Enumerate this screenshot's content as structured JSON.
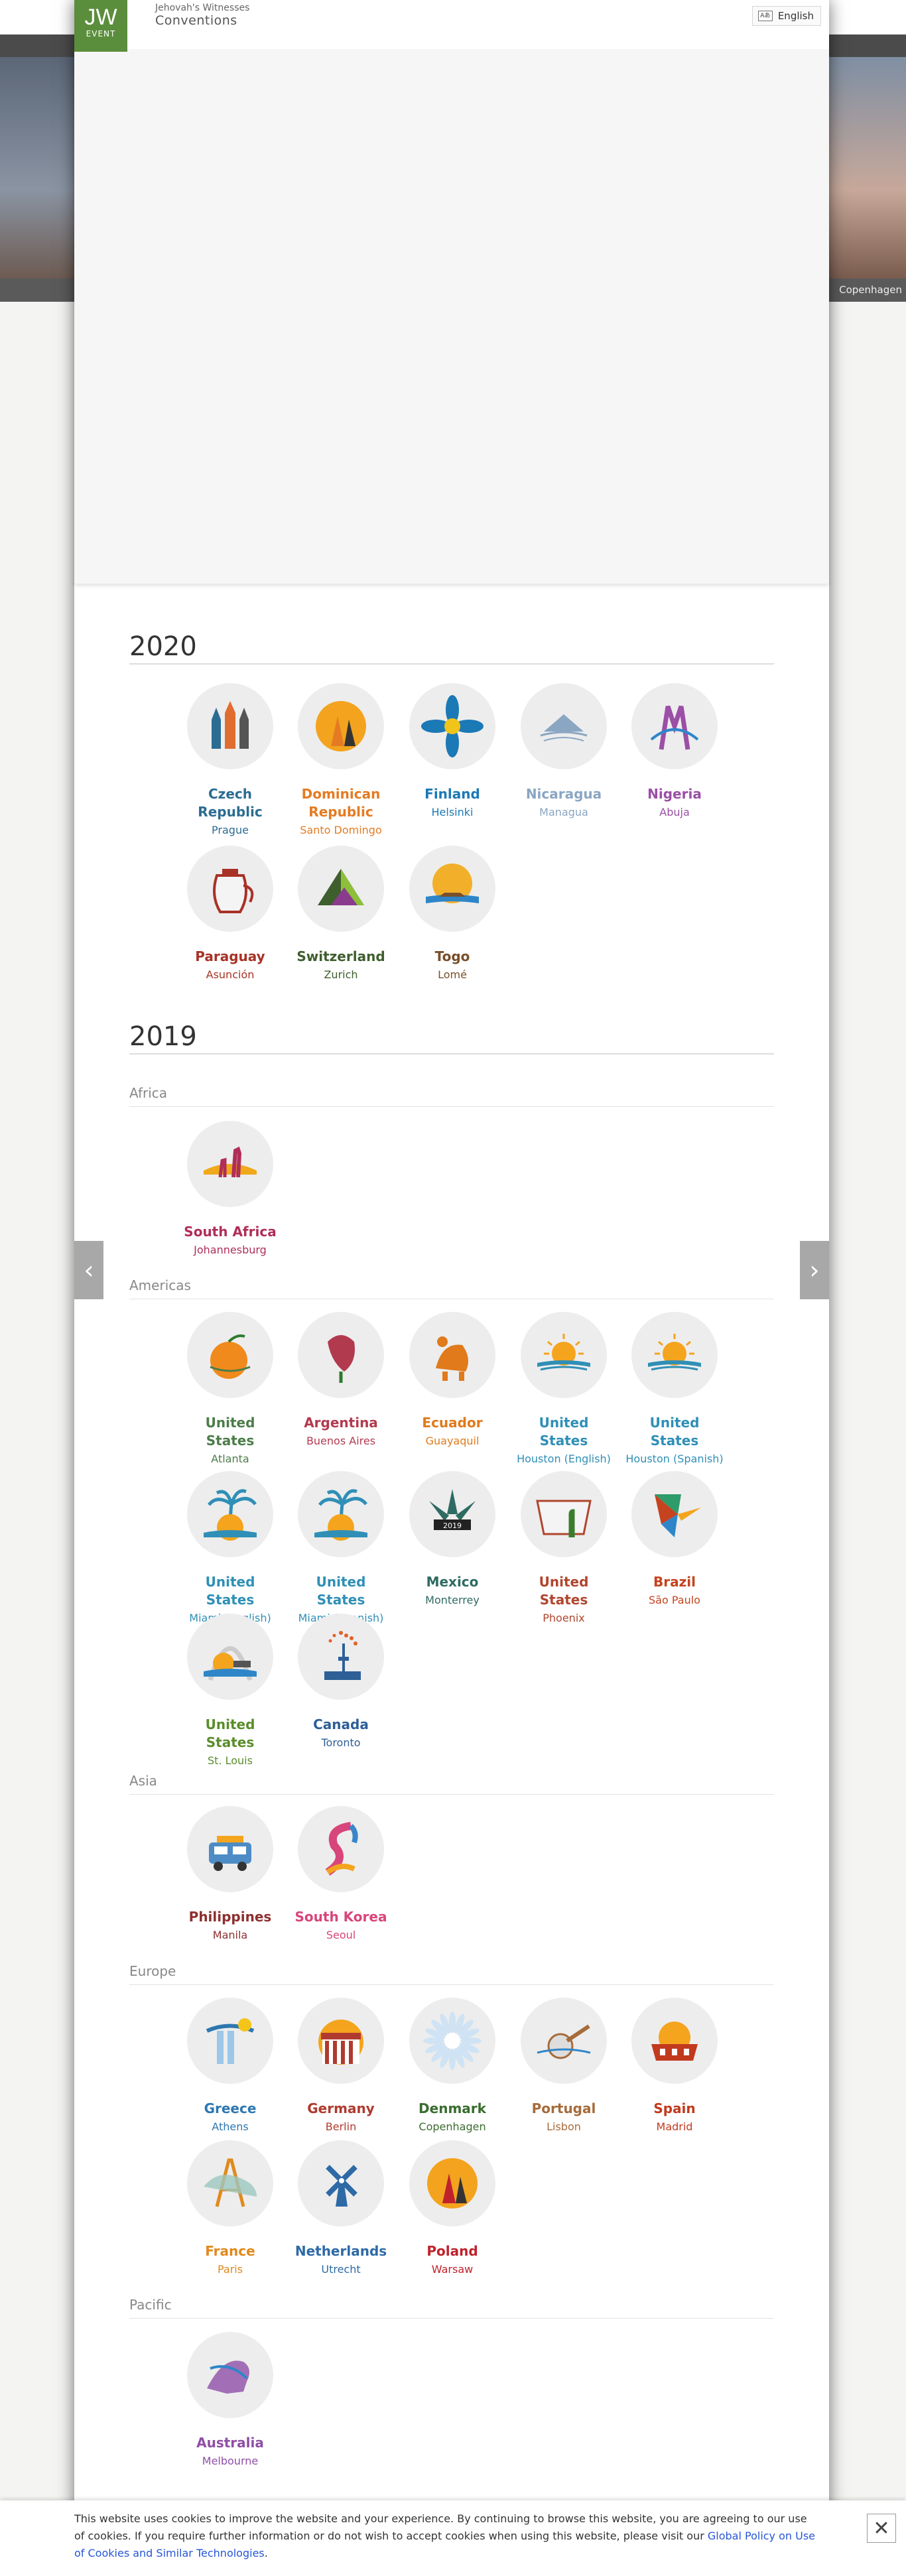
{
  "header": {
    "logo_main": "JW",
    "logo_sub": "EVENT",
    "org": "Jehovah's Witnesses",
    "site": "Conventions",
    "lang_icon": "Aあ",
    "language": "English"
  },
  "hero": {
    "caption": "Copenhagen"
  },
  "years": [
    {
      "label": "2020",
      "events": [
        {
          "country": "Czech Republic",
          "city": "Prague",
          "color": "#2b6c92",
          "icon": "castle-icon"
        },
        {
          "country": "Dominican Republic",
          "city": "Santo Domingo",
          "color": "#e47b22",
          "icon": "dancers-icon"
        },
        {
          "country": "Finland",
          "city": "Helsinki",
          "color": "#1b79b6",
          "icon": "flower-icon"
        },
        {
          "country": "Nicaragua",
          "city": "Managua",
          "color": "#8aa6c2",
          "icon": "volcano-icon"
        },
        {
          "country": "Nigeria",
          "city": "Abuja",
          "color": "#9b4fa6",
          "icon": "bridge-icon"
        },
        {
          "country": "Paraguay",
          "city": "Asunción",
          "color": "#a83226",
          "icon": "teapot-icon"
        },
        {
          "country": "Switzerland",
          "city": "Zurich",
          "color": "#3f5e2e",
          "icon": "mountain-icon"
        },
        {
          "country": "Togo",
          "city": "Lomé",
          "color": "#7a4f2a",
          "icon": "boat-icon"
        }
      ]
    },
    {
      "label": "2019",
      "regions": [
        {
          "name": "Africa",
          "events": [
            {
              "country": "South Africa",
              "city": "Johannesburg",
              "color": "#b02e57",
              "icon": "giraffe-icon"
            }
          ]
        },
        {
          "name": "Americas",
          "events": [
            {
              "country": "United States",
              "city": "Atlanta",
              "color": "#4c7d49",
              "icon": "peach-icon"
            },
            {
              "country": "Argentina",
              "city": "Buenos Aires",
              "color": "#b23a4f",
              "icon": "ceibo-flower-icon"
            },
            {
              "country": "Ecuador",
              "city": "Guayaquil",
              "color": "#e07a1b",
              "icon": "tortoise-icon"
            },
            {
              "country": "United States",
              "city": "Houston (English)",
              "color": "#2f8fb6",
              "icon": "sun-boat-icon"
            },
            {
              "country": "United States",
              "city": "Houston (Spanish)",
              "color": "#2f8fb6",
              "icon": "sun-boat-icon"
            },
            {
              "country": "United States",
              "city": "Miami (English)",
              "color": "#2f8fb6",
              "icon": "palm-island-icon"
            },
            {
              "country": "United States",
              "city": "Miami (Spanish)",
              "color": "#2f8fb6",
              "icon": "palm-island-icon"
            },
            {
              "country": "Mexico",
              "city": "Monterrey",
              "color": "#2e6b62",
              "icon": "agave-icon"
            },
            {
              "country": "United States",
              "city": "Phoenix",
              "color": "#b0462e",
              "icon": "cactus-icon"
            },
            {
              "country": "Brazil",
              "city": "São Paulo",
              "color": "#c5431f",
              "icon": "hummingbird-icon"
            },
            {
              "country": "United States",
              "city": "St. Louis",
              "color": "#5a8d2b",
              "icon": "arch-icon"
            },
            {
              "country": "Canada",
              "city": "Toronto",
              "color": "#2e5f97",
              "icon": "cn-tower-icon"
            }
          ]
        },
        {
          "name": "Asia",
          "events": [
            {
              "country": "Philippines",
              "city": "Manila",
              "color": "#8d2f2f",
              "icon": "jeepney-icon"
            },
            {
              "country": "South Korea",
              "city": "Seoul",
              "color": "#d8457a",
              "icon": "ribbon-icon"
            }
          ]
        },
        {
          "name": "Europe",
          "events": [
            {
              "country": "Greece",
              "city": "Athens",
              "color": "#2e77b0",
              "icon": "column-icon"
            },
            {
              "country": "Germany",
              "city": "Berlin",
              "color": "#b03a2e",
              "icon": "gate-icon"
            },
            {
              "country": "Denmark",
              "city": "Copenhagen",
              "color": "#3a6d2f",
              "icon": "daisy-icon"
            },
            {
              "country": "Portugal",
              "city": "Lisbon",
              "color": "#a66b3a",
              "icon": "guitar-icon"
            },
            {
              "country": "Spain",
              "city": "Madrid",
              "color": "#c23a1e",
              "icon": "arena-icon"
            },
            {
              "country": "France",
              "city": "Paris",
              "color": "#e08a1c",
              "icon": "eiffel-icon"
            },
            {
              "country": "Netherlands",
              "city": "Utrecht",
              "color": "#2e6aa6",
              "icon": "windmill-icon"
            },
            {
              "country": "Poland",
              "city": "Warsaw",
              "color": "#c0222c",
              "icon": "dancers-icon"
            }
          ]
        },
        {
          "name": "Pacific",
          "events": [
            {
              "country": "Australia",
              "city": "Melbourne",
              "color": "#8f4fa7",
              "icon": "kangaroo-icon"
            }
          ]
        }
      ]
    }
  ],
  "cookie": {
    "text": "This website uses cookies to improve the website and your experience. By continuing to browse this website, you are agreeing to our use of cookies. If you require further information or do not wish to accept cookies when using this website, please visit our ",
    "link": "Global Policy on Use of Cookies and Similar Technologies",
    "end": ".",
    "close": "✕"
  },
  "nav": {
    "prev": "‹",
    "next": "›"
  }
}
